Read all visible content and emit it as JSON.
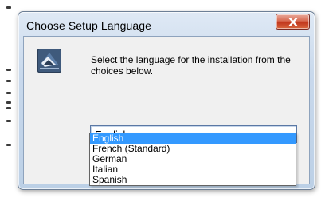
{
  "window": {
    "title": "Choose Setup Language",
    "close_label": "close"
  },
  "dialog": {
    "prompt": "Select the language for the installation from the choices below."
  },
  "language_select": {
    "selected": "English",
    "options": [
      "English",
      "French (Standard)",
      "German",
      "Italian",
      "Spanish"
    ]
  },
  "colors": {
    "selection": "#3399ff",
    "close_button": "#c1361c",
    "frame": "#bcd0e6"
  },
  "icons": {
    "app": "installer-icon",
    "close": "close-icon",
    "dropdown": "chevron-down-icon"
  }
}
